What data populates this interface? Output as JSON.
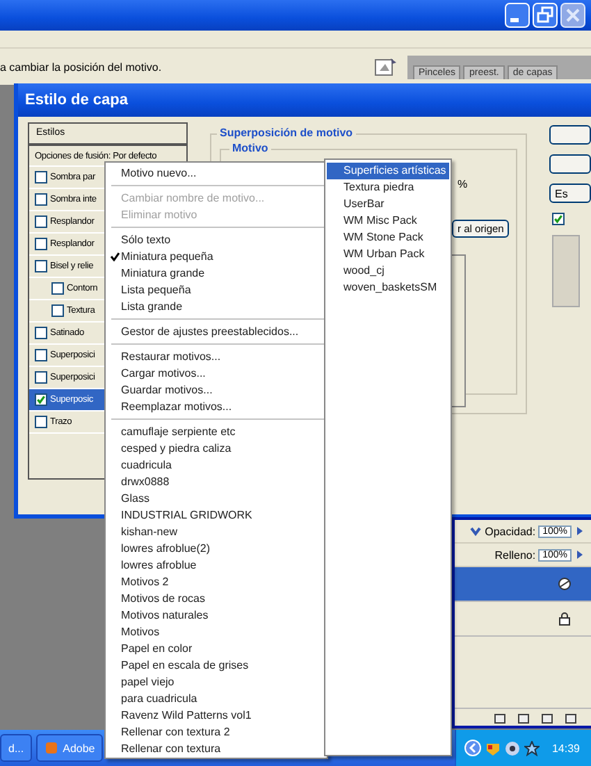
{
  "options_bar": {
    "hint": "a cambiar la posición del motivo.",
    "palette_tabs": [
      "Pinceles",
      "preest.",
      "de capas"
    ]
  },
  "dialog": {
    "title": "Estilo de capa",
    "styles_panel": {
      "header": "Estilos",
      "blend_options": "Opciones de fusión: Por defecto",
      "items": [
        {
          "label": "Sombra par",
          "checked": false,
          "selected": false
        },
        {
          "label": "Sombra inte",
          "checked": false,
          "selected": false
        },
        {
          "label": "Resplandor",
          "checked": false,
          "selected": false
        },
        {
          "label": "Resplandor",
          "checked": false,
          "selected": false
        },
        {
          "label": "Bisel y relie",
          "checked": false,
          "selected": false,
          "children": [
            {
              "label": "Contorn",
              "checked": false,
              "selected": false
            },
            {
              "label": "Textura",
              "checked": false,
              "selected": false
            }
          ]
        },
        {
          "label": "Satinado",
          "checked": false,
          "selected": false
        },
        {
          "label": "Superposici",
          "checked": false,
          "selected": false
        },
        {
          "label": "Superposici",
          "checked": false,
          "selected": false
        },
        {
          "label": "Superposic",
          "checked": true,
          "selected": true
        },
        {
          "label": "Trazo",
          "checked": false,
          "selected": false
        }
      ]
    },
    "group_title": "Superposición de motivo",
    "subgroup_title": "Motivo",
    "percent": "%",
    "origin_button": "r al origen",
    "side_button": "Es",
    "preview_checked": true
  },
  "context_menu": [
    {
      "kind": "item",
      "label": "Motivo nuevo...",
      "disabled": false,
      "checked": false
    },
    {
      "kind": "separator"
    },
    {
      "kind": "item",
      "label": "Cambiar nombre de motivo...",
      "disabled": true,
      "checked": false
    },
    {
      "kind": "item",
      "label": "Eliminar motivo",
      "disabled": true,
      "checked": false
    },
    {
      "kind": "separator"
    },
    {
      "kind": "item",
      "label": "Sólo texto",
      "disabled": false,
      "checked": false
    },
    {
      "kind": "item",
      "label": "Miniatura pequeña",
      "disabled": false,
      "checked": true
    },
    {
      "kind": "item",
      "label": "Miniatura grande",
      "disabled": false,
      "checked": false
    },
    {
      "kind": "item",
      "label": "Lista pequeña",
      "disabled": false,
      "checked": false
    },
    {
      "kind": "item",
      "label": "Lista grande",
      "disabled": false,
      "checked": false
    },
    {
      "kind": "separator"
    },
    {
      "kind": "item",
      "label": "Gestor de ajustes preestablecidos...",
      "disabled": false,
      "checked": false
    },
    {
      "kind": "separator"
    },
    {
      "kind": "item",
      "label": "Restaurar motivos...",
      "disabled": false,
      "checked": false
    },
    {
      "kind": "item",
      "label": "Cargar motivos...",
      "disabled": false,
      "checked": false
    },
    {
      "kind": "item",
      "label": "Guardar motivos...",
      "disabled": false,
      "checked": false
    },
    {
      "kind": "item",
      "label": "Reemplazar motivos...",
      "disabled": false,
      "checked": false
    },
    {
      "kind": "separator"
    },
    {
      "kind": "item",
      "label": "camuflaje serpiente etc",
      "disabled": false,
      "checked": false
    },
    {
      "kind": "item",
      "label": "cesped y piedra caliza",
      "disabled": false,
      "checked": false
    },
    {
      "kind": "item",
      "label": "cuadricula",
      "disabled": false,
      "checked": false
    },
    {
      "kind": "item",
      "label": "drwx0888",
      "disabled": false,
      "checked": false
    },
    {
      "kind": "item",
      "label": "Glass",
      "disabled": false,
      "checked": false
    },
    {
      "kind": "item",
      "label": "INDUSTRIAL GRIDWORK",
      "disabled": false,
      "checked": false
    },
    {
      "kind": "item",
      "label": "kishan-new",
      "disabled": false,
      "checked": false
    },
    {
      "kind": "item",
      "label": "lowres afroblue(2)",
      "disabled": false,
      "checked": false
    },
    {
      "kind": "item",
      "label": "lowres afroblue",
      "disabled": false,
      "checked": false
    },
    {
      "kind": "item",
      "label": "Motivos 2",
      "disabled": false,
      "checked": false
    },
    {
      "kind": "item",
      "label": "Motivos de rocas",
      "disabled": false,
      "checked": false
    },
    {
      "kind": "item",
      "label": "Motivos naturales",
      "disabled": false,
      "checked": false
    },
    {
      "kind": "item",
      "label": "Motivos",
      "disabled": false,
      "checked": false
    },
    {
      "kind": "item",
      "label": "Papel en color",
      "disabled": false,
      "checked": false
    },
    {
      "kind": "item",
      "label": "Papel en escala de grises",
      "disabled": false,
      "checked": false
    },
    {
      "kind": "item",
      "label": "papel viejo",
      "disabled": false,
      "checked": false
    },
    {
      "kind": "item",
      "label": "para cuadricula",
      "disabled": false,
      "checked": false
    },
    {
      "kind": "item",
      "label": "Ravenz Wild Patterns vol1",
      "disabled": false,
      "checked": false
    },
    {
      "kind": "item",
      "label": "Rellenar con textura 2",
      "disabled": false,
      "checked": false
    },
    {
      "kind": "item",
      "label": "Rellenar con textura",
      "disabled": false,
      "checked": false
    }
  ],
  "submenu": [
    {
      "label": "Superficies artísticas",
      "selected": true
    },
    {
      "label": "Textura piedra",
      "selected": false
    },
    {
      "label": "UserBar",
      "selected": false
    },
    {
      "label": "WM Misc Pack",
      "selected": false
    },
    {
      "label": "WM Stone Pack",
      "selected": false
    },
    {
      "label": "WM Urban Pack",
      "selected": false
    },
    {
      "label": "wood_cj",
      "selected": false
    },
    {
      "label": "woven_basketsSM",
      "selected": false
    }
  ],
  "layers_panel": {
    "opacity_label": "Opacidad:",
    "opacity": "100%",
    "fill_label": "Relleno:",
    "fill": "100%",
    "rows": [
      {
        "selected": true
      },
      {
        "selected": false
      }
    ]
  },
  "taskbar": {
    "buttons": [
      "d...",
      "Adobe"
    ],
    "clock": "14:39"
  }
}
